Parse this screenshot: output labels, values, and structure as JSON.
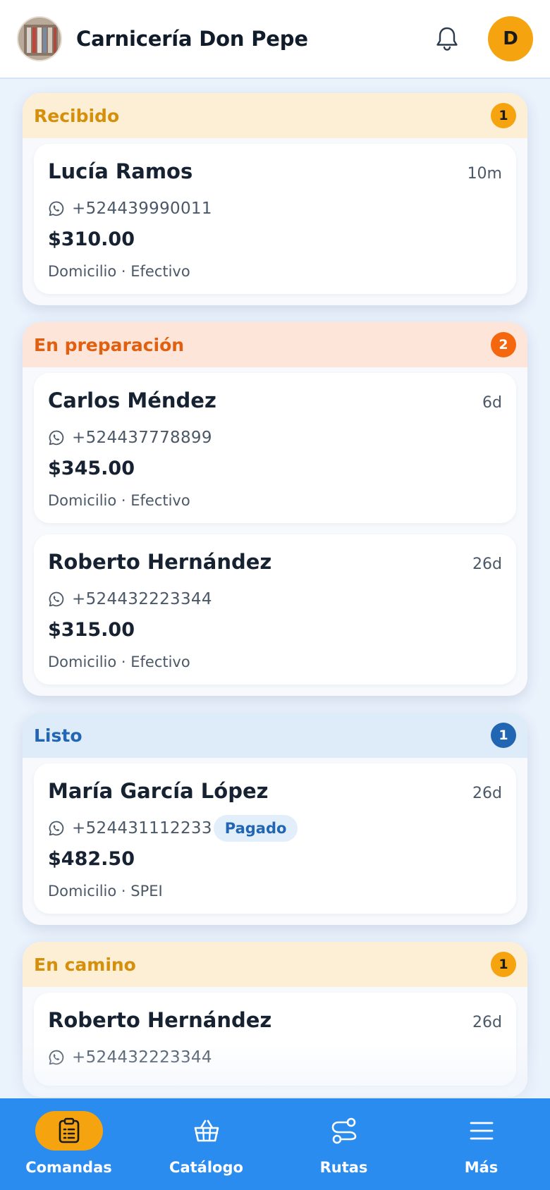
{
  "header": {
    "shop_name": "Carnicería Don Pepe",
    "user_initial": "D"
  },
  "columns": [
    {
      "title": "Recibido",
      "count": "1",
      "colors": {
        "header_bg": "#fcefd6",
        "title": "#d58f0a",
        "badge_bg": "#f5a30f",
        "badge_text": "#1a1a1a"
      },
      "orders": [
        {
          "name": "Lucía Ramos",
          "time": "10m",
          "phone": "+524439990011",
          "amount": "$310.00",
          "meta": "Domicilio · Efectivo",
          "paid": ""
        }
      ]
    },
    {
      "title": "En preparación",
      "count": "2",
      "colors": {
        "header_bg": "#fde6d9",
        "title": "#e15f10",
        "badge_bg": "#f4670f",
        "badge_text": "#ffffff"
      },
      "orders": [
        {
          "name": "Carlos Méndez",
          "time": "6d",
          "phone": "+524437778899",
          "amount": "$345.00",
          "meta": "Domicilio · Efectivo",
          "paid": ""
        },
        {
          "name": "Roberto Hernández",
          "time": "26d",
          "phone": "+524432223344",
          "amount": "$315.00",
          "meta": "Domicilio · Efectivo",
          "paid": ""
        }
      ]
    },
    {
      "title": "Listo",
      "count": "1",
      "colors": {
        "header_bg": "#deebf9",
        "title": "#2266b3",
        "badge_bg": "#2266b3",
        "badge_text": "#ffffff"
      },
      "orders": [
        {
          "name": "María García López",
          "time": "26d",
          "phone": "+524431112233",
          "amount": "$482.50",
          "meta": "Domicilio · SPEI",
          "paid": "Pagado"
        }
      ]
    },
    {
      "title": "En camino",
      "count": "1",
      "colors": {
        "header_bg": "#fcefd6",
        "title": "#d58f0a",
        "badge_bg": "#f5a30f",
        "badge_text": "#1a1a1a"
      },
      "orders": [
        {
          "name": "Roberto Hernández",
          "time": "26d",
          "phone": "+524432223344",
          "amount": "",
          "meta": "",
          "paid": ""
        }
      ]
    }
  ],
  "nav": {
    "items": [
      {
        "label": "Comandas",
        "icon": "clipboard-icon",
        "active": true
      },
      {
        "label": "Catálogo",
        "icon": "basket-icon",
        "active": false
      },
      {
        "label": "Rutas",
        "icon": "route-icon",
        "active": false
      },
      {
        "label": "Más",
        "icon": "menu-icon",
        "active": false
      }
    ],
    "colors": {
      "bar": "#2b8cf0",
      "active_pill": "#f5a30f"
    }
  }
}
